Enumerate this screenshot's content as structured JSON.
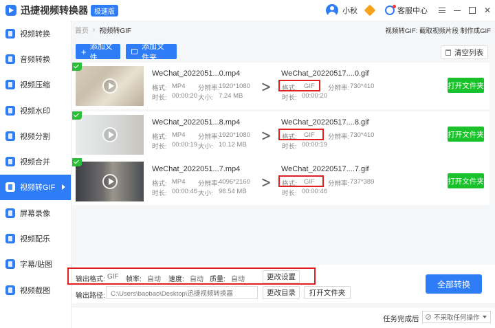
{
  "app": {
    "title": "迅捷视频转换器",
    "edition": "极速版",
    "user_name": "小秋",
    "service_label": "客服中心"
  },
  "sidebar": {
    "items": [
      {
        "label": "视频转换",
        "icon": "video-convert-icon"
      },
      {
        "label": "音频转换",
        "icon": "audio-convert-icon"
      },
      {
        "label": "视频压缩",
        "icon": "video-compress-icon"
      },
      {
        "label": "视频水印",
        "icon": "video-watermark-icon"
      },
      {
        "label": "视频分割",
        "icon": "video-split-icon"
      },
      {
        "label": "视频合并",
        "icon": "video-merge-icon"
      },
      {
        "label": "视频转GIF",
        "icon": "video-gif-icon"
      },
      {
        "label": "屏幕录像",
        "icon": "screen-record-icon"
      },
      {
        "label": "视频配乐",
        "icon": "video-music-icon"
      },
      {
        "label": "字幕/贴图",
        "icon": "subtitle-icon"
      },
      {
        "label": "视频截图",
        "icon": "video-screenshot-icon"
      }
    ],
    "active_index": 6
  },
  "breadcrumb": {
    "home": "首页",
    "sep": "›",
    "current": "视频转GIF",
    "right_text": "视频转GIF: 截取视频片段 制作成GIF"
  },
  "toolbar": {
    "add_file": "添加文件",
    "add_folder": "添加文件夹",
    "clear_list": "清空列表"
  },
  "labels": {
    "format": "格式:",
    "resolution": "分辨率:",
    "duration": "时长:",
    "size": "大小:",
    "open_folder": "打开文件夹"
  },
  "files": [
    {
      "src_name": "WeChat_2022051...0.mp4",
      "src_format": "MP4",
      "src_resolution": "1920*1080",
      "src_duration": "00:00:20",
      "src_size": "7.24 MB",
      "out_name": "WeChat_20220517....0.gif",
      "out_format": "GIF",
      "out_resolution": "730*410",
      "out_duration": "00:00:20"
    },
    {
      "src_name": "WeChat_2022051...8.mp4",
      "src_format": "MP4",
      "src_resolution": "1920*1080",
      "src_duration": "00:00:19",
      "src_size": "10.12 MB",
      "out_name": "WeChat_20220517....8.gif",
      "out_format": "GIF",
      "out_resolution": "730*410",
      "out_duration": "00:00:19"
    },
    {
      "src_name": "WeChat_2022051...7.mp4",
      "src_format": "MP4",
      "src_resolution": "4096*2160",
      "src_duration": "00:00:46",
      "src_size": "96.54 MB",
      "out_name": "WeChat_20220517....7.gif",
      "out_format": "GIF",
      "out_resolution": "737*389",
      "out_duration": "00:00:46"
    }
  ],
  "output": {
    "format_label": "输出格式:",
    "format_value": "GIF",
    "fps_label": "帧率:",
    "fps_value": "自动",
    "speed_label": "速度:",
    "speed_value": "自动",
    "quality_label": "质量:",
    "quality_value": "自动",
    "change_settings": "更改设置",
    "path_label": "输出路径:",
    "path_value": "C:\\Users\\baobao\\Desktop\\迅捷视频转换器",
    "change_dir": "更改目录",
    "open_folder": "打开文件夹",
    "convert_all": "全部转换"
  },
  "status": {
    "task_done_label": "任务完成后",
    "task_done_option": "不采取任何操作"
  },
  "colors": {
    "accent": "#2e7cf6",
    "green": "#19c22a",
    "highlight_red": "#e02020"
  }
}
